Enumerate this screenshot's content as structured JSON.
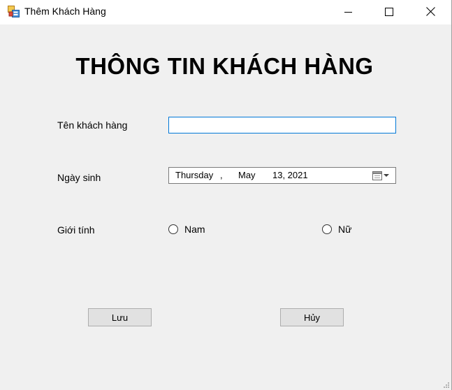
{
  "window": {
    "title": "Thêm Khách Hàng",
    "app_icon": "form-icon",
    "controls": {
      "minimize_icon": "minimize-icon",
      "maximize_icon": "maximize-icon",
      "close_icon": "close-icon"
    }
  },
  "form": {
    "heading": "THÔNG TIN KHÁCH HÀNG",
    "customer_name": {
      "label": "Tên khách hàng",
      "value": ""
    },
    "birthdate": {
      "label": "Ngày sinh",
      "weekday": "Thursday",
      "separator": ",",
      "month": "May",
      "day_year": "13, 2021",
      "dropdown_icon": "calendar-dropdown-icon"
    },
    "gender": {
      "label": "Giới tính",
      "options": [
        {
          "label": "Nam",
          "selected": false
        },
        {
          "label": "Nữ",
          "selected": false
        }
      ]
    },
    "buttons": {
      "save_label": "Lưu",
      "cancel_label": "Hủy"
    }
  },
  "colors": {
    "window_bg": "#f0f0f0",
    "titlebar_bg": "#ffffff",
    "focus_border": "#0078d7",
    "button_bg": "#e1e1e1"
  }
}
